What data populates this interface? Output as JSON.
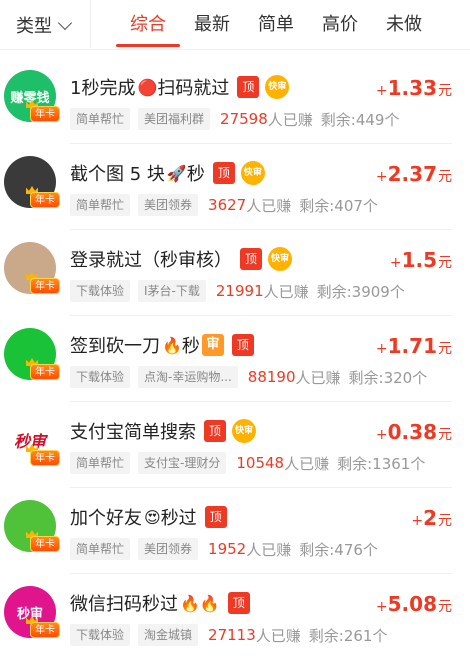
{
  "header": {
    "type_label": "类型",
    "tabs": [
      {
        "label": "综合",
        "active": true
      },
      {
        "label": "最新",
        "active": false
      },
      {
        "label": "简单",
        "active": false
      },
      {
        "label": "高价",
        "active": false
      },
      {
        "label": "未做",
        "active": false
      }
    ]
  },
  "colors": {
    "accent": "#ee3a24",
    "tag_bg": "#f3f3f3",
    "muted": "#999999"
  },
  "badges": {
    "top": "顶",
    "fast": "快审",
    "shen": "审",
    "annual": "年卡",
    "plus": "+",
    "unit": "元",
    "earned_suffix": "人已赚"
  },
  "tasks": [
    {
      "title": "1秒完成",
      "emoji": "🔴",
      "title_tail": "扫码就过",
      "has_fast": true,
      "has_shen": false,
      "tags": [
        "简单帮忙",
        "美团福利群"
      ],
      "earned": "27598",
      "remaining": "剩余:449个",
      "amount": "1.33",
      "avatar_text": "赚零钱",
      "avatar_color": "#1fbf6a"
    },
    {
      "title": "截个图 5 块",
      "emoji": "🚀",
      "title_tail": "秒",
      "has_fast": true,
      "has_shen": false,
      "tags": [
        "简单帮忙",
        "美团领券"
      ],
      "earned": "3627",
      "remaining": "剩余:407个",
      "amount": "2.37",
      "avatar_text": "",
      "avatar_color": "#3a3a3a"
    },
    {
      "title": "登录就过（秒审核）",
      "emoji": "",
      "title_tail": "",
      "has_fast": true,
      "has_shen": false,
      "tags": [
        "下载体验",
        "I茅台-下载"
      ],
      "earned": "21991",
      "remaining": "剩余:3909个",
      "amount": "1.5",
      "avatar_text": "",
      "avatar_color": "#c9a98a"
    },
    {
      "title": "签到砍一刀",
      "emoji": "🔥",
      "title_tail": "秒",
      "has_fast": false,
      "has_shen": true,
      "tags": [
        "下载体验",
        "点淘-幸运购物..."
      ],
      "earned": "88190",
      "remaining": "剩余:320个",
      "amount": "1.71",
      "avatar_text": "",
      "avatar_color": "#19c236"
    },
    {
      "title": "支付宝简单搜索",
      "emoji": "",
      "title_tail": "",
      "has_fast": true,
      "has_shen": false,
      "tags": [
        "简单帮忙",
        "支付宝-理财分"
      ],
      "earned": "10548",
      "remaining": "剩余:1361个",
      "amount": "0.38",
      "avatar_text": "秒审",
      "avatar_color": "#ffffff"
    },
    {
      "title": "加个好友",
      "emoji": "😍",
      "title_tail": "秒过",
      "has_fast": false,
      "has_shen": false,
      "tags": [
        "简单帮忙",
        "美团领券"
      ],
      "earned": "1952",
      "remaining": "剩余:476个",
      "amount": "2",
      "avatar_text": "",
      "avatar_color": "#4fc23a"
    },
    {
      "title": "微信扫码秒过",
      "emoji": "🔥🔥",
      "title_tail": "",
      "has_fast": false,
      "has_shen": false,
      "tags": [
        "下载体验",
        "淘金城镇"
      ],
      "earned": "27113",
      "remaining": "剩余:261个",
      "amount": "5.08",
      "avatar_text": "秒审",
      "avatar_color": "#e0148c"
    }
  ]
}
